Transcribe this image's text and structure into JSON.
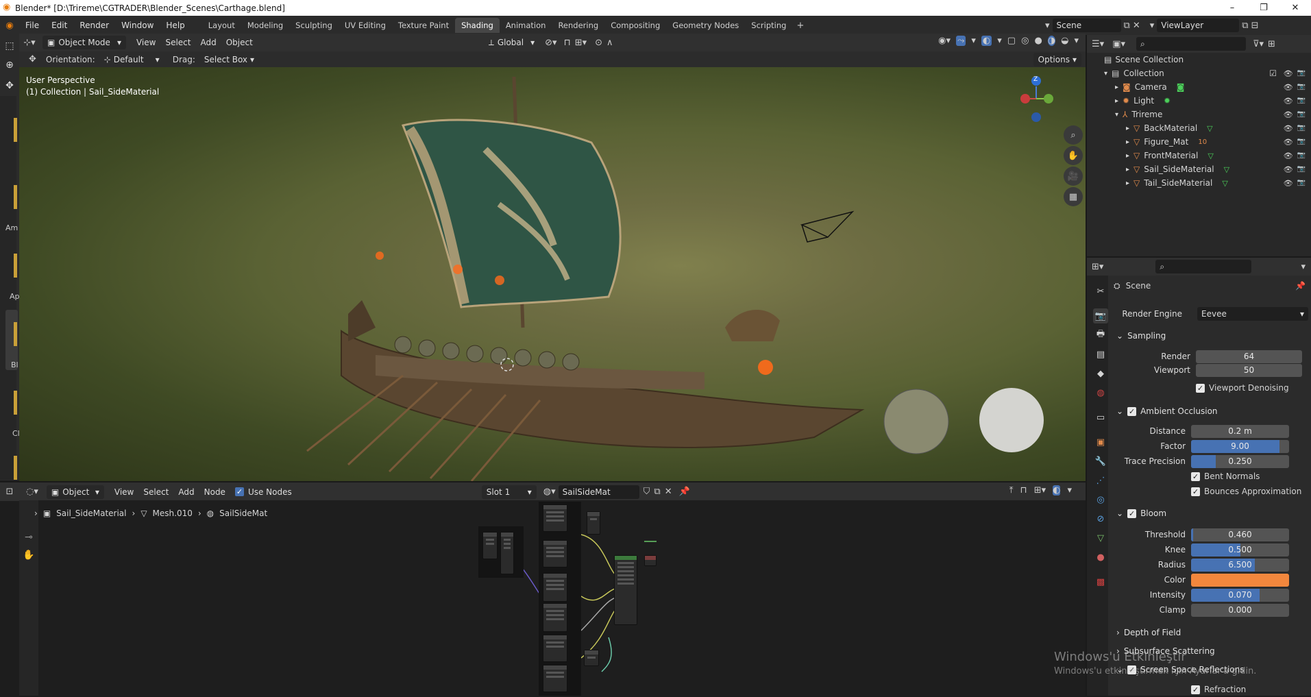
{
  "window": {
    "title": "Blender* [D:\\Trireme\\CGTRADER\\Blender_Scenes\\Carthage.blend]",
    "controls": [
      "–",
      "❐",
      "✕"
    ]
  },
  "menu": [
    "File",
    "Edit",
    "Render",
    "Window",
    "Help"
  ],
  "workspaces": [
    {
      "label": "Layout",
      "active": false
    },
    {
      "label": "Modeling",
      "active": false
    },
    {
      "label": "Sculpting",
      "active": false
    },
    {
      "label": "UV Editing",
      "active": false
    },
    {
      "label": "Texture Paint",
      "active": false
    },
    {
      "label": "Shading",
      "active": true
    },
    {
      "label": "Animation",
      "active": false
    },
    {
      "label": "Rendering",
      "active": false
    },
    {
      "label": "Compositing",
      "active": false
    },
    {
      "label": "Geometry Nodes",
      "active": false
    },
    {
      "label": "Scripting",
      "active": false
    }
  ],
  "scene_field": "Scene",
  "viewlayer_field": "ViewLayer",
  "viewport_header": {
    "mode": "Object Mode",
    "menus": [
      "View",
      "Select",
      "Add",
      "Object"
    ],
    "transform_orientation": "Global"
  },
  "tool_header": {
    "orientation_label": "Orientation:",
    "orientation_value": "Default",
    "drag_label": "Drag:",
    "drag_value": "Select Box",
    "options": "Options"
  },
  "viewport": {
    "perspective": "User Perspective",
    "collection_info": "(1) Collection | Sail_SideMaterial",
    "gizmo_z": "Z"
  },
  "left_strip_labels": [
    "Am",
    "Ap",
    "Bl",
    "Cl"
  ],
  "outliner": {
    "root": "Scene Collection",
    "items": [
      {
        "label": "Collection",
        "depth": 0,
        "icon": "collection-icon",
        "color": "#cccccc"
      },
      {
        "label": "Camera",
        "depth": 1,
        "icon": "camera-icon",
        "color": "#e08a4b"
      },
      {
        "label": "Light",
        "depth": 1,
        "icon": "light-icon",
        "color": "#e08a4b"
      },
      {
        "label": "Trireme",
        "depth": 1,
        "icon": "empty-icon",
        "color": "#e08a4b"
      },
      {
        "label": "BackMaterial",
        "depth": 2,
        "icon": "mesh-icon",
        "color": "#e08a4b"
      },
      {
        "label": "Figure_Mat",
        "depth": 2,
        "icon": "mesh-icon",
        "color": "#e08a4b",
        "badge": "10"
      },
      {
        "label": "FrontMaterial",
        "depth": 2,
        "icon": "mesh-icon",
        "color": "#e08a4b"
      },
      {
        "label": "Sail_SideMaterial",
        "depth": 2,
        "icon": "mesh-icon",
        "color": "#e08a4b"
      },
      {
        "label": "Tail_SideMaterial",
        "depth": 2,
        "icon": "mesh-icon",
        "color": "#e08a4b"
      }
    ]
  },
  "properties": {
    "context": "Scene",
    "render_engine_label": "Render Engine",
    "render_engine": "Eevee",
    "sampling": {
      "title": "Sampling",
      "render_label": "Render",
      "render": "64",
      "viewport_label": "Viewport",
      "viewport": "50",
      "denoise_label": "Viewport Denoising"
    },
    "ao": {
      "title": "Ambient Occlusion",
      "distance_label": "Distance",
      "distance": "0.2 m",
      "factor_label": "Factor",
      "factor": "9.00",
      "factor_fill": 0.9,
      "trace_label": "Trace Precision",
      "trace": "0.250",
      "trace_fill": 0.25,
      "bent_label": "Bent Normals",
      "bounces_label": "Bounces Approximation"
    },
    "bloom": {
      "title": "Bloom",
      "threshold_label": "Threshold",
      "threshold": "0.460",
      "threshold_fill": 0.02,
      "knee_label": "Knee",
      "knee": "0.500",
      "knee_fill": 0.5,
      "radius_label": "Radius",
      "radius": "6.500",
      "radius_fill": 0.65,
      "color_label": "Color",
      "color": "#f2873d",
      "intensity_label": "Intensity",
      "intensity": "0.070",
      "intensity_fill": 0.7,
      "clamp_label": "Clamp",
      "clamp": "0.000"
    },
    "dof": "Depth of Field",
    "sss": "Subsurface Scattering",
    "ssr": "Screen Space Reflections",
    "refraction": "Refraction"
  },
  "node_editor": {
    "type": "Object",
    "menus": [
      "View",
      "Select",
      "Add",
      "Node"
    ],
    "use_nodes": "Use Nodes",
    "slot": "Slot 1",
    "material": "SailSideMat",
    "breadcrumb": [
      "Sail_SideMaterial",
      "Mesh.010",
      "SailSideMat"
    ]
  },
  "watermark": {
    "line1": "Windows'u Etkinleştir",
    "line2": "Windows'u etkinleştirmek için Ayarlar'a gidin."
  }
}
